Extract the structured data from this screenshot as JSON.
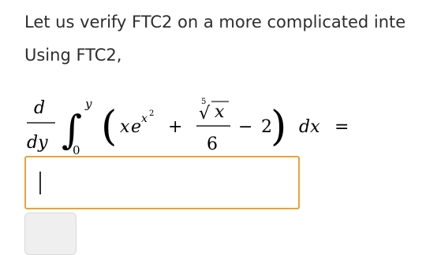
{
  "text": {
    "line1": "Let us verify FTC2 on a more complicated inte",
    "line2": "Using FTC2,"
  },
  "formula": {
    "d": "d",
    "dy": "dy",
    "integral": "∫",
    "upper_limit": "y",
    "lower_limit": "0",
    "open_paren": "(",
    "x": "x",
    "e": "e",
    "exp_x": "x",
    "exp_2": "2",
    "plus": "+",
    "root_index": "5",
    "radical": "√",
    "radicand": "x",
    "denominator": "6",
    "minus": "−",
    "two": "2",
    "close_paren": ")",
    "dx": "dx",
    "equals": "="
  },
  "answer_input": {
    "value": ""
  },
  "colors": {
    "input_border": "#e8a33a",
    "button_bg": "#efefef"
  }
}
